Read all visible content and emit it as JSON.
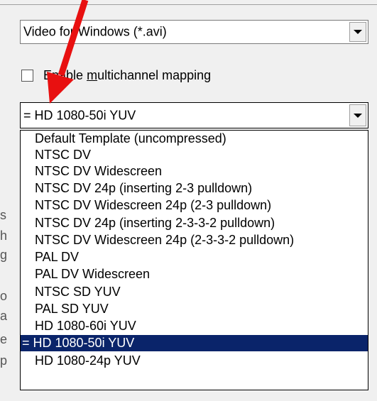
{
  "format_combo": {
    "value": "Video for Windows (*.avi)"
  },
  "multichannel": {
    "label_pre": "Enable ",
    "label_underlined": "m",
    "label_post": "ultichannel mapping",
    "checked": false
  },
  "template_combo": {
    "value": "= HD 1080-50i YUV"
  },
  "template_options": [
    {
      "label": "Default Template (uncompressed)"
    },
    {
      "label": "NTSC DV"
    },
    {
      "label": "NTSC DV Widescreen"
    },
    {
      "label": "NTSC DV 24p (inserting 2-3 pulldown)"
    },
    {
      "label": "NTSC DV Widescreen 24p (2-3 pulldown)"
    },
    {
      "label": "NTSC DV 24p (inserting 2-3-3-2 pulldown)"
    },
    {
      "label": "NTSC DV Widescreen 24p (2-3-3-2 pulldown)"
    },
    {
      "label": "PAL DV"
    },
    {
      "label": "PAL DV Widescreen"
    },
    {
      "label": "NTSC SD YUV"
    },
    {
      "label": "PAL SD YUV"
    },
    {
      "label": "HD 1080-60i YUV"
    },
    {
      "label": "= HD 1080-50i YUV",
      "selected": true
    },
    {
      "label": "HD 1080-24p YUV"
    }
  ],
  "background_labels": [
    "s",
    "h",
    "g",
    "o",
    "a",
    "e",
    "p"
  ],
  "annotation": {
    "color": "#e81010"
  }
}
